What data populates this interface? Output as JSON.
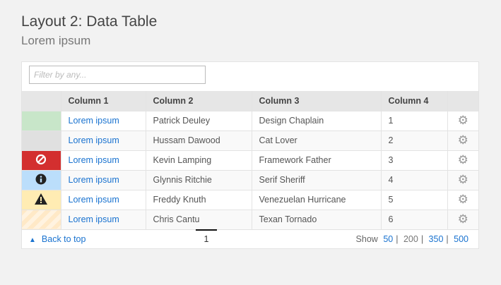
{
  "header": {
    "title": "Layout 2: Data Table",
    "subtitle": "Lorem ipsum"
  },
  "filter": {
    "placeholder": "Filter by any..."
  },
  "columns": [
    "",
    "Column 1",
    "Column 2",
    "Column 3",
    "Column 4",
    ""
  ],
  "rows": [
    {
      "status": "success",
      "status_color": "#c8e6c9",
      "icon": "",
      "col1": "Lorem ipsum",
      "col2": "Patrick Deuley",
      "col3": "Design Chaplain",
      "col4": "1"
    },
    {
      "status": "neutral",
      "status_color": "#e0e0e0",
      "icon": "",
      "col1": "Lorem ipsum",
      "col2": "Hussam Dawood",
      "col3": "Cat Lover",
      "col4": "2"
    },
    {
      "status": "error",
      "status_color": "#d32f2f",
      "icon": "ban-icon",
      "col1": "Lorem ipsum",
      "col2": "Kevin Lamping",
      "col3": "Framework Father",
      "col4": "3"
    },
    {
      "status": "info",
      "status_color": "#bbdefb",
      "icon": "info-icon",
      "col1": "Lorem ipsum",
      "col2": "Glynnis Ritchie",
      "col3": "Serif Sheriff",
      "col4": "4"
    },
    {
      "status": "warning",
      "status_color": "#ffecb3",
      "icon": "warning-icon",
      "col1": "Lorem ipsum",
      "col2": "Freddy Knuth",
      "col3": "Venezuelan Hurricane",
      "col4": "5"
    },
    {
      "status": "pending",
      "status_color": "#ffe6c0",
      "icon": "",
      "col1": "Lorem ipsum",
      "col2": "Chris Cantu",
      "col3": "Texan Tornado",
      "col4": "6"
    }
  ],
  "footer": {
    "back_label": "Back to top",
    "page": "1",
    "show_label": "Show",
    "sizes": [
      "50",
      "200",
      "350",
      "500"
    ],
    "separator": "|"
  }
}
